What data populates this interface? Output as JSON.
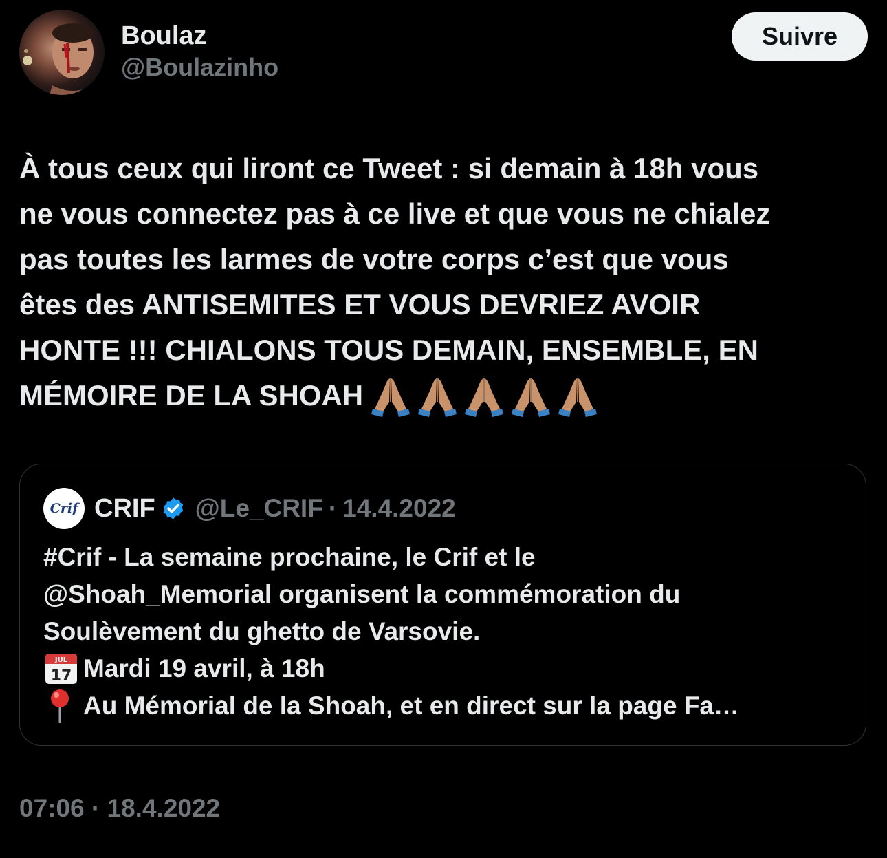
{
  "author": {
    "display_name": "Boulaz",
    "handle": "@Boulazinho",
    "avatar": "avatar-photo"
  },
  "follow_label": "Suivre",
  "tweet": {
    "lines": [
      "À tous ceux qui liront ce Tweet : si demain à 18h vous",
      "ne vous connectez pas à ce live et que vous ne chialez",
      "pas toutes les larmes de votre corps c’est que vous",
      "êtes des ANTISEMITES ET VOUS DEVRIEZ AVOIR",
      "HONTE !!! CHIALONS TOUS DEMAIN, ENSEMBLE, EN",
      "MÉMOIRE DE LA SHOAH"
    ],
    "emoji": "🙏🏽🙏🏽🙏🏽🙏🏽🙏🏽",
    "emoji_icon": "praying-hands-icon",
    "emoji_count": 5
  },
  "quote": {
    "avatar_text": "Crif",
    "name": "CRIF",
    "verified_icon": "verified-badge-icon",
    "verified_color": "#1d9bf0",
    "handle": "@Le_CRIF",
    "separator": "·",
    "date": "14.4.2022",
    "lines": [
      "#Crif - La semaine prochaine, le Crif et le",
      "@Shoah_Memorial organisent la commémoration du",
      "Soulèvement du ghetto de Varsovie."
    ],
    "date_line": {
      "icon": "calendar-icon",
      "calendar_month": "JUL",
      "calendar_day": "17",
      "text": "Mardi 19 avril, à 18h"
    },
    "place_line": {
      "icon": "pushpin-icon",
      "text": "Au Mémorial de la Shoah, et en direct sur la page Fa…"
    }
  },
  "timestamp": {
    "time": "07:06",
    "separator": "·",
    "date": "18.4.2022"
  },
  "colors": {
    "background": "#000000",
    "text": "#e7e9ea",
    "muted": "#71767b",
    "border": "#2f3336",
    "button_bg": "#eff3f4"
  }
}
